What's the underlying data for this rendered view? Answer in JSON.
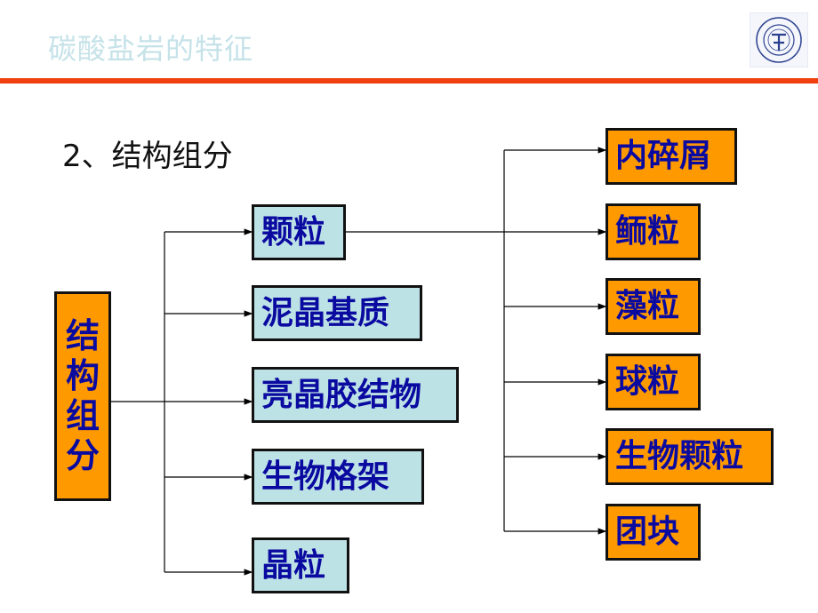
{
  "header": {
    "title": "碳酸盐岩的特征",
    "logo": "china-university-of-geosciences-logo",
    "accent_color": "#f0400f"
  },
  "subtitle": "2、结构组分",
  "diagram": {
    "root": {
      "label": "结构组分",
      "chars": [
        "结",
        "构",
        "组",
        "分"
      ]
    },
    "components": [
      {
        "label": "颗粒"
      },
      {
        "label": "泥晶基质"
      },
      {
        "label": "亮晶胶结物"
      },
      {
        "label": "生物格架"
      },
      {
        "label": "晶粒"
      }
    ],
    "grain_types": [
      {
        "label": "内碎屑"
      },
      {
        "label": "鲕粒"
      },
      {
        "label": "藻粒"
      },
      {
        "label": "球粒"
      },
      {
        "label": "生物颗粒"
      },
      {
        "label": "团块"
      }
    ],
    "colors": {
      "component_fill": "#bde2e6",
      "grain_fill": "#ff9900",
      "text": "#0a0aa0"
    }
  }
}
